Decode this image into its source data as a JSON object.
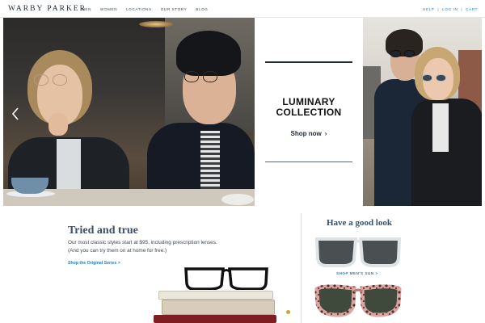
{
  "header": {
    "logo": "WARBY PARKER",
    "nav": [
      "MEN",
      "WOMEN",
      "LOCATIONS",
      "OUR STORY",
      "BLOG"
    ],
    "utility": {
      "help": "HELP",
      "separator": "|",
      "login": "LOG IN",
      "cart": "CART"
    }
  },
  "hero": {
    "prev_icon": "chevron-left-icon",
    "title_line1": "LUMINARY",
    "title_line2": "COLLECTION",
    "cta": "Shop now",
    "cta_arrow": "›"
  },
  "tried": {
    "title": "Tried and true",
    "line1": "Our most classic styles start at $95, including prescription lenses.",
    "line2": "(And you can try them on at home for free.)",
    "link": "Shop the Original Series >"
  },
  "good_look": {
    "title": "Have a good look",
    "link1": "SHOP MEN'S SUN >"
  },
  "colors": {
    "link": "#2a7dbf",
    "heading": "#3b4e63",
    "text": "#1f2a36"
  }
}
